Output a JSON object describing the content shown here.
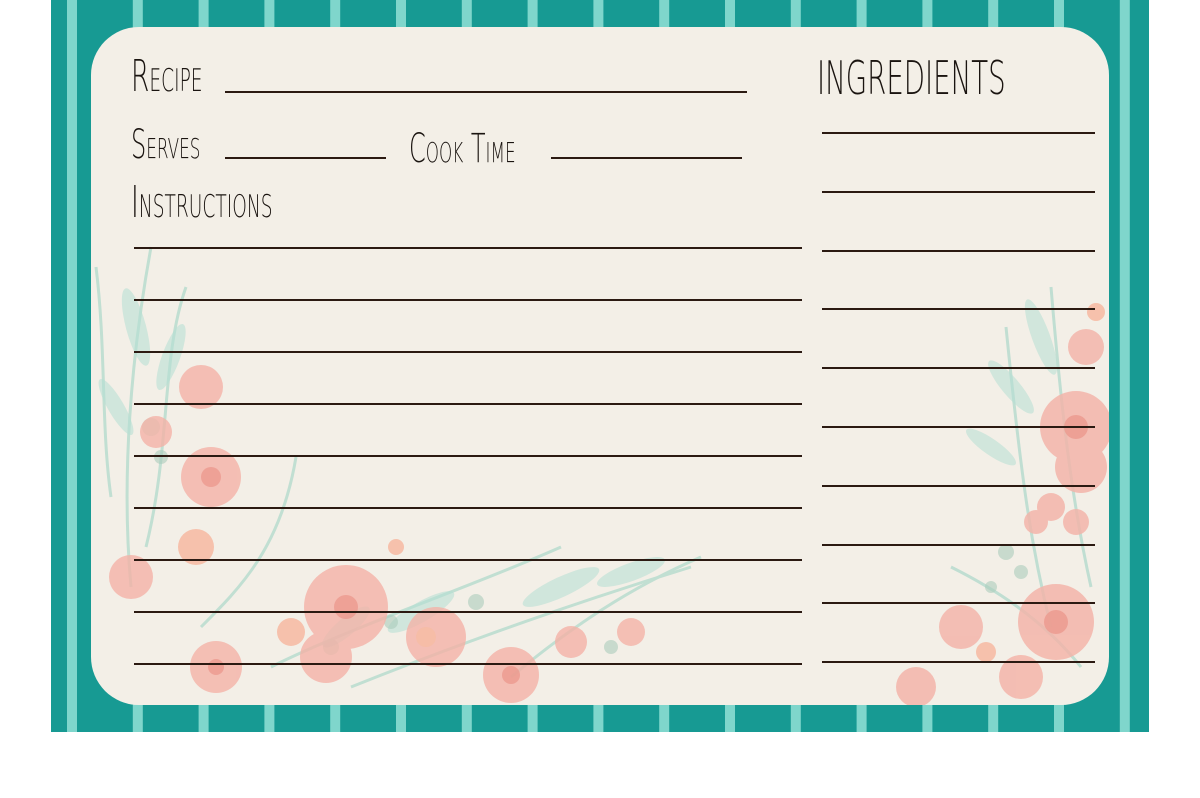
{
  "card": {
    "recipe_label": "Recipe",
    "serves_label": "Serves",
    "cook_time_label": "Cook Time",
    "instructions_label": "Instructions",
    "ingredients_label": "INGREDIENTS"
  },
  "colors": {
    "teal": "#179a93",
    "stripe": "#7fd6cc",
    "card": "#f3efe7",
    "ink": "#2b1a12",
    "peach": "#f4a79c",
    "coral": "#f08b7e",
    "mint": "#a9dccf",
    "sage": "#9fc7b4"
  },
  "icons": [
    "watercolor-floral-left-icon",
    "watercolor-floral-right-icon"
  ]
}
